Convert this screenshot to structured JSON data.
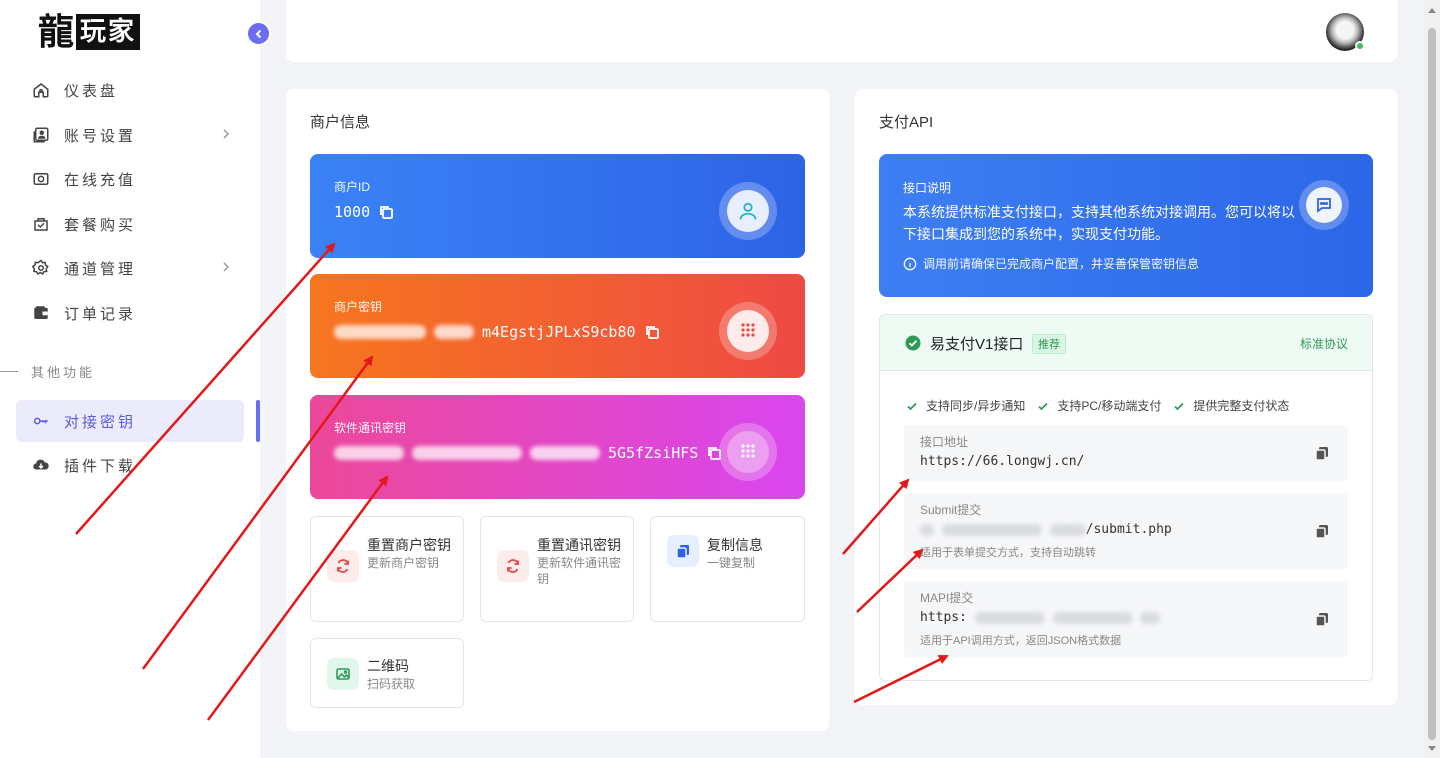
{
  "brand": {
    "char1": "龍",
    "char2": "玩家"
  },
  "sidebar": {
    "items": [
      {
        "label": "仪表盘",
        "icon": "home-icon"
      },
      {
        "label": "账号设置",
        "icon": "account-icon"
      },
      {
        "label": "在线充值",
        "icon": "recharge-icon"
      },
      {
        "label": "套餐购买",
        "icon": "package-icon"
      },
      {
        "label": "通道管理",
        "icon": "gear-icon"
      },
      {
        "label": "订单记录",
        "icon": "wallet-icon"
      }
    ],
    "section": "其他功能",
    "extra": [
      {
        "label": "对接密钥",
        "icon": "key-icon",
        "active": true
      },
      {
        "label": "插件下载",
        "icon": "cloud-download-icon"
      }
    ]
  },
  "merchant": {
    "title": "商户信息",
    "id_label": "商户ID",
    "id_value": "1000",
    "key_label": "商户密钥",
    "key_visible": "m4EgstjJPLxS9cb80",
    "comm_label": "软件通讯密钥",
    "comm_visible": "5G5fZsiHFS",
    "actions": [
      {
        "title": "重置商户密钥",
        "sub": "更新商户密钥",
        "icon": "refresh-icon"
      },
      {
        "title": "重置通讯密钥",
        "sub": "更新软件通讯密钥",
        "icon": "refresh-icon"
      },
      {
        "title": "复制信息",
        "sub": "一键复制",
        "icon": "copy-icon"
      },
      {
        "title": "二维码",
        "sub": "扫码获取",
        "icon": "image-icon"
      }
    ]
  },
  "api": {
    "title": "支付API",
    "info_label": "接口说明",
    "info_desc": "本系统提供标准支付接口，支持其他系统对接调用。您可以将以下接口集成到您的系统中，实现支付功能。",
    "info_note": "调用前请确保已完成商户配置，并妥善保管密钥信息",
    "epay_name": "易支付V1接口",
    "epay_badge": "推荐",
    "epay_protocol": "标准协议",
    "features": [
      "支持同步/异步通知",
      "支持PC/移动端支付",
      "提供完整支付状态"
    ],
    "endpoints": [
      {
        "label": "接口地址",
        "value": "https://66.longwj.cn/",
        "hint": ""
      },
      {
        "label": "Submit提交",
        "value": "/submit.php",
        "hint": "适用于表单提交方式，支持自动跳转"
      },
      {
        "label": "MAPI提交",
        "value": "https:",
        "hint": "适用于API调用方式，返回JSON格式数据"
      }
    ]
  },
  "colors": {
    "accent": "#6c6cf0",
    "blue": "#3a7bf2",
    "orange": "#f5702a",
    "pink": "#e94aa0",
    "green": "#2e9a55",
    "arrow": "#e31818"
  }
}
